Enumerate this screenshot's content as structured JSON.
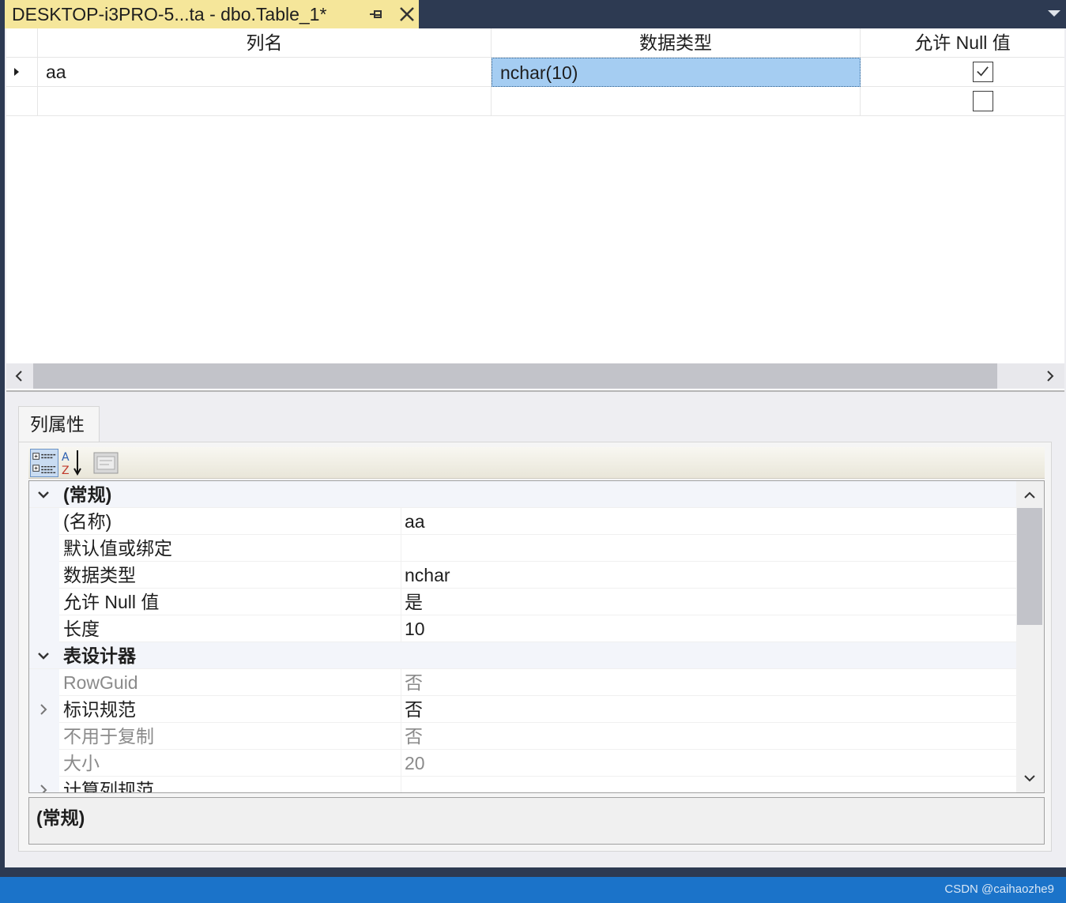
{
  "tab": {
    "title": "DESKTOP-i3PRO-5...ta - dbo.Table_1*",
    "pin_icon": "pin-icon",
    "close_icon": "close-icon"
  },
  "grid": {
    "columns": [
      "列名",
      "数据类型",
      "允许 Null 值"
    ],
    "rows": [
      {
        "name": "aa",
        "type": "nchar(10)",
        "allow_null": true
      },
      {
        "name": "",
        "type": "",
        "allow_null": false
      }
    ]
  },
  "properties": {
    "tab_label": "列属性",
    "categories": [
      {
        "label": "(常规)",
        "items": [
          {
            "name": "(名称)",
            "value": "aa"
          },
          {
            "name": "默认值或绑定",
            "value": ""
          },
          {
            "name": "数据类型",
            "value": "nchar"
          },
          {
            "name": "允许 Null 值",
            "value": "是"
          },
          {
            "name": "长度",
            "value": "10"
          }
        ]
      },
      {
        "label": "表设计器",
        "items": [
          {
            "name": "RowGuid",
            "value": "否",
            "dim": true
          },
          {
            "name": "标识规范",
            "value": "否",
            "expandable": true
          },
          {
            "name": "不用于复制",
            "value": "否",
            "dim": true
          },
          {
            "name": "大小",
            "value": "20",
            "dim": true
          },
          {
            "name": "计算列规范",
            "value": "",
            "expandable": true
          }
        ]
      }
    ],
    "description_title": "(常规)"
  },
  "status": {
    "watermark": "CSDN @caihaozhe9"
  },
  "colors": {
    "tab_bg": "#f5e69a",
    "chrome_bg": "#2d3a52",
    "selected_cell": "#a5cdf2",
    "status_bar": "#1b73c9"
  }
}
